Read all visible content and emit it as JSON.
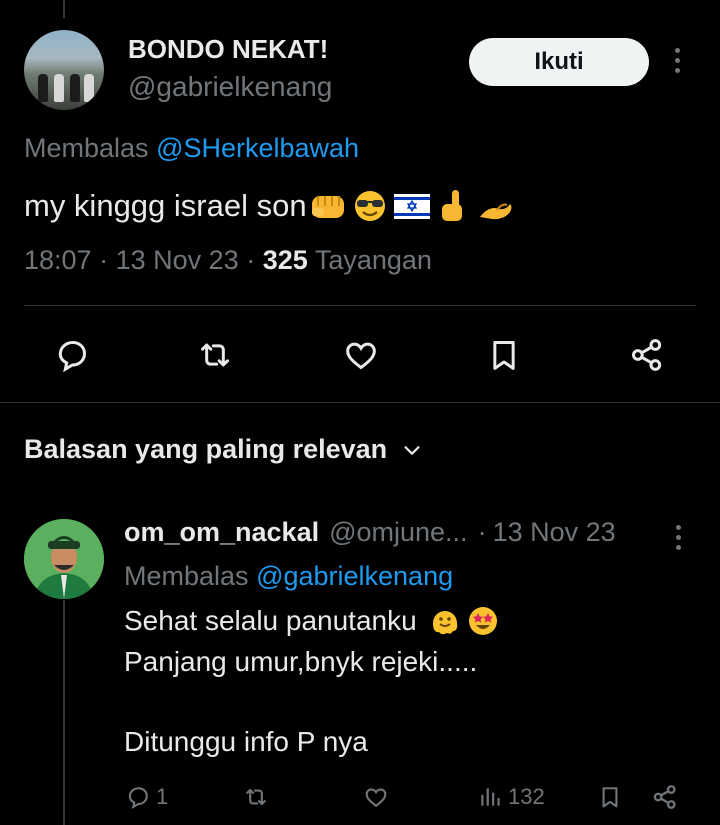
{
  "tweet": {
    "display_name": "BONDO NEKAT!",
    "handle": "@gabrielkenang",
    "follow_label": "Ikuti",
    "reply_prefix": "Membalas",
    "reply_to": "@SHerkelbawah",
    "text": "my kinggg israel son",
    "emojis": [
      "oncoming-fist",
      "smiling-face-with-sunglasses",
      "flag-israel",
      "index-pointing-up",
      "flexed-arm"
    ],
    "time": "18:07",
    "separator": "·",
    "date": "13 Nov 23",
    "views_count": "325",
    "views_label": "Tayangan"
  },
  "actions": [
    "reply-icon",
    "retweet-icon",
    "like-icon",
    "bookmark-icon",
    "share-icon"
  ],
  "replies_header": {
    "label": "Balasan yang paling relevan",
    "icon": "chevron-down-icon"
  },
  "reply": {
    "display_name": "om_om_nackal",
    "handle": "@omjune...",
    "separator": "·",
    "date": "13 Nov 23",
    "reply_prefix": "Membalas",
    "reply_to": "@gabrielkenang",
    "line1": "Sehat selalu panutanku",
    "line1_emojis": [
      "melting-face",
      "star-struck"
    ],
    "line2": "Panjang umur,bnyk rejeki.....",
    "line3": "Ditunggu info P nya",
    "reply_count": "1",
    "views_count": "132"
  },
  "colors": {
    "background": "#000000",
    "text": "#e7e9ea",
    "secondary": "#71767b",
    "link": "#1d9bf0",
    "divider": "#2f3336",
    "follow_button_bg": "#eff3f4"
  }
}
